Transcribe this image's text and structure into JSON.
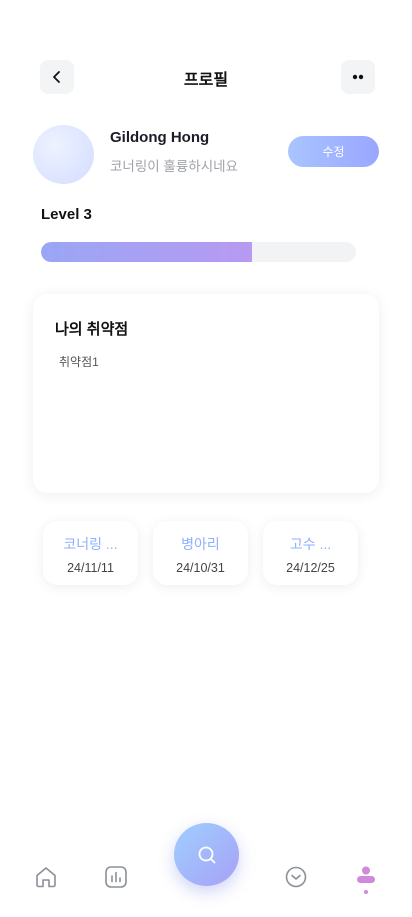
{
  "header": {
    "title": "프로필",
    "back_icon": "chevron-left-icon",
    "more_icon": "more-dots-icon"
  },
  "profile": {
    "name": "Gildong Hong",
    "status": "코너링이 훌륭하시네요",
    "edit_label": "수정"
  },
  "level": {
    "label": "Level 3",
    "progress_percent": 67
  },
  "weaknesses": {
    "title": "나의 취약점",
    "items": [
      "취약점1"
    ]
  },
  "badges": [
    {
      "name": "코너링 ...",
      "date": "24/11/11"
    },
    {
      "name": "병아리",
      "date": "24/10/31"
    },
    {
      "name": "고수 ...",
      "date": "24/12/25"
    }
  ],
  "tabbar": {
    "tabs": [
      "home-icon",
      "chart-icon",
      "search-icon",
      "chevron-circle-icon",
      "profile-icon"
    ],
    "active": "profile-icon"
  },
  "colors": {
    "accent_start": "#9aa6f5",
    "accent_end": "#b79af2",
    "badge_text": "#8eb0ff",
    "profile_active": "#d08adc"
  }
}
